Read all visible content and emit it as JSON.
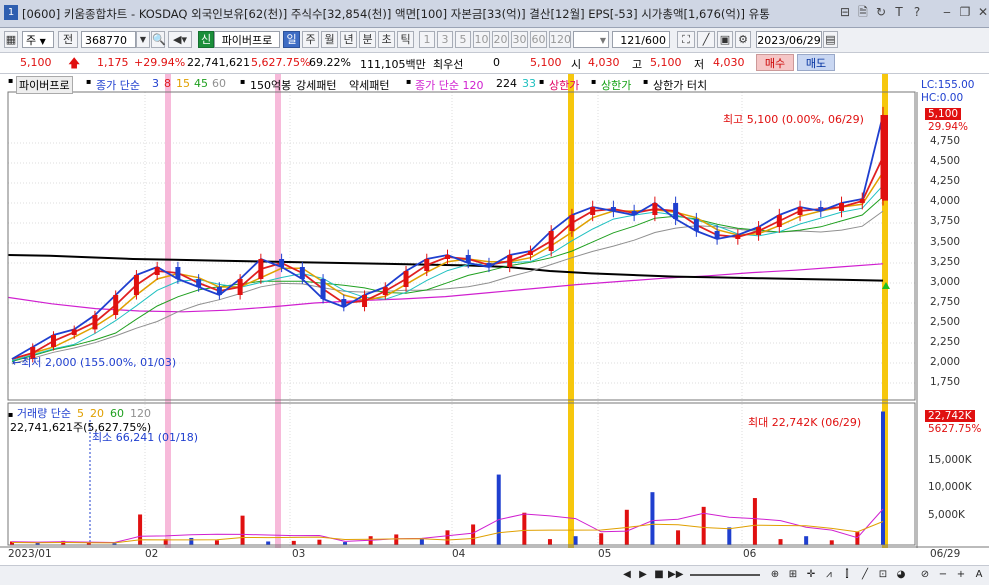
{
  "window": {
    "number": "1",
    "title": "[0600] 키움종합차트 - KOSDAQ 외국인보유[62(천)] 주식수[32,854(천)] 액면[100] 자본금[33(억)] 결산[12월] EPS[-53] 시가총액[1,676(억)] 유통",
    "icons": [
      "layout-icon",
      "save-icon",
      "refresh-icon",
      "pin-icon",
      "help-icon",
      "minimize-icon",
      "restore-icon",
      "close-icon"
    ],
    "icon_glyphs": [
      "⊟",
      "🗎",
      "↻",
      "T",
      "?",
      "‒",
      "❐",
      "✕"
    ]
  },
  "toolbar": {
    "period_select": "주",
    "jeon_label": "전",
    "code": "368770",
    "name_badge": "신",
    "stock_name": "파이버프로",
    "interval_buttons": [
      "일",
      "주",
      "월",
      "년",
      "분",
      "초",
      "틱"
    ],
    "selected_interval": "일",
    "number_buttons": [
      "1",
      "3",
      "5",
      "10",
      "20",
      "30",
      "60",
      "120"
    ],
    "count": "121",
    "count_total": "/600",
    "date": "2023/06/29"
  },
  "info": {
    "price": "5,100",
    "change": "1,175",
    "change_rate": "+29.94%",
    "volume": "22,741,621",
    "volume_rate": "5,627.75%",
    "turnover": "69.22%",
    "amount": "111,105백만",
    "preferred_label": "최우선",
    "preferred_value": "0",
    "last": "5,100",
    "open_label": "시",
    "open": "4,030",
    "high_label": "고",
    "high": "5,100",
    "low_label": "저",
    "low": "4,030",
    "buy_label": "매수",
    "sell_label": "매도"
  },
  "legend": {
    "name": "파이버프로",
    "ma_label": "종가 단순",
    "ma_periods": [
      "3",
      "8",
      "15",
      "45",
      "60"
    ],
    "ma_colors": [
      "#1f3fcf",
      "#e02020",
      "#e0a000",
      "#20a020",
      "#909090"
    ],
    "line150": "150억봉",
    "strong": "강세패턴",
    "weak": "약세패턴",
    "ma120_label": "종가 단순 120",
    "ma224": "224",
    "ma33": "33",
    "upper_limit1": "상한가",
    "upper_limit2": "상한가",
    "upper_touch": "상한가 터치"
  },
  "price_axis": {
    "lc": "LC:155.00",
    "hc": "HC:0.00",
    "current": "5,100",
    "current_rate": "29.94%",
    "ticks": [
      "4,750",
      "4,500",
      "4,250",
      "4,000",
      "3,750",
      "3,500",
      "3,250",
      "3,000",
      "2,750",
      "2,500",
      "2,250",
      "2,000",
      "1,750"
    ]
  },
  "annotations": {
    "high": "최고 5,100 (0.00%, 06/29)",
    "low": "최저 2,000 (155.00%, 01/03)",
    "vol_max": "최대 22,742K (06/29)",
    "vol_min": "최소 66,241 (01/18)"
  },
  "volume_panel": {
    "label": "거래량",
    "ma_label": "단순",
    "ma_periods": [
      "5",
      "20",
      "60",
      "120"
    ],
    "ma_colors": [
      "#e0a000",
      "#e0a000",
      "#20a020",
      "#909090"
    ],
    "value": "22,741,621주(5,627.75%)",
    "current": "22,742K",
    "current_rate": "5627.75%",
    "ticks": [
      "15,000K",
      "10,000K",
      "5,000K"
    ]
  },
  "x_axis": {
    "labels": [
      "2023/01",
      "02",
      "03",
      "04",
      "05",
      "06",
      "06/29"
    ]
  },
  "chart_data": {
    "type": "candlestick",
    "price_range": [
      1620,
      5150
    ],
    "volume_range": [
      0,
      23000
    ],
    "x": [
      "2023/01",
      "02",
      "03",
      "04",
      "05",
      "06",
      "06/29"
    ],
    "close_path": [
      2050,
      2200,
      2350,
      2420,
      2600,
      2850,
      3100,
      3200,
      3050,
      2950,
      2850,
      3050,
      3300,
      3200,
      3050,
      2800,
      2700,
      2850,
      2950,
      3150,
      3300,
      3350,
      3250,
      3200,
      3350,
      3400,
      3650,
      3850,
      3950,
      3900,
      3850,
      4000,
      3800,
      3650,
      3550,
      3600,
      3700,
      3850,
      3950,
      3900,
      4000,
      4050,
      5100
    ],
    "ma224": [
      3350,
      3340,
      3320,
      3300,
      3290,
      3280,
      3270,
      3260,
      3250,
      3240,
      3230,
      3220,
      3200,
      3150,
      3120,
      3100,
      3080,
      3070,
      3060,
      3050,
      3040,
      3030
    ],
    "ma120": [
      2820,
      2740,
      2680,
      2650,
      2640,
      2660,
      2700,
      2750,
      2780,
      2800,
      2830,
      2880,
      2930,
      2980,
      3020,
      3060,
      3090,
      3130,
      3160,
      3200,
      3240
    ],
    "volume": [
      600,
      500,
      700,
      400,
      300,
      5200,
      1000,
      1200,
      800,
      5000,
      600,
      700,
      900,
      500,
      1500,
      1800,
      1200,
      2500,
      3500,
      12000,
      5500,
      1000,
      1500,
      2000,
      6000,
      9000,
      2500,
      6500,
      3000,
      8000,
      1000,
      1500,
      800,
      2200,
      22742
    ],
    "upper_limit_days": [
      "02/03",
      "03/02",
      "04/26",
      "06/29"
    ],
    "high": {
      "value": 5100,
      "date": "06/29"
    },
    "low": {
      "value": 2000,
      "date": "01/03"
    },
    "volume_max": {
      "value": 22742,
      "date": "06/29"
    },
    "volume_min": {
      "value": 66.241,
      "date": "01/18"
    }
  }
}
